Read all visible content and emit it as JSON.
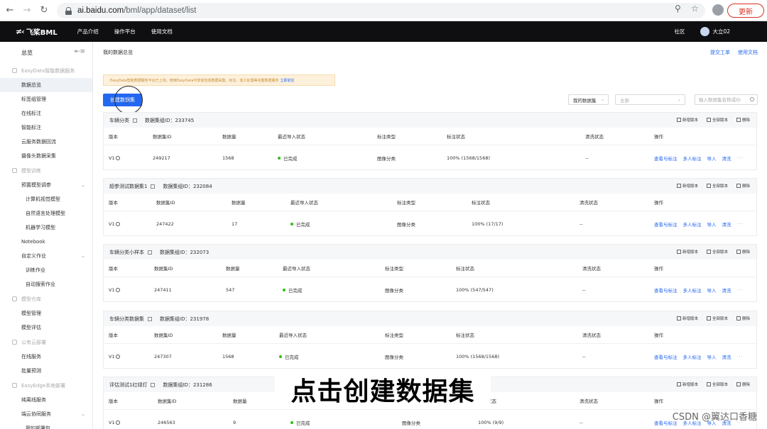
{
  "browser": {
    "url_host": "ai.baidu.com",
    "url_path": "/bml/app/dataset/list",
    "update_label": "更新"
  },
  "topbar": {
    "logo": "飞桨BML",
    "nav": [
      "产品介绍",
      "操作平台",
      "使用文档"
    ],
    "community": "社区",
    "user": "大立02"
  },
  "sidebar": {
    "header": "总览",
    "items": [
      {
        "kind": "group",
        "label": "EasyData智能数据服务"
      },
      {
        "kind": "item",
        "label": "数据总览",
        "active": true
      },
      {
        "kind": "item",
        "label": "标签组管理"
      },
      {
        "kind": "item",
        "label": "在线标注"
      },
      {
        "kind": "item",
        "label": "智能标注"
      },
      {
        "kind": "item",
        "label": "云服务数据回流"
      },
      {
        "kind": "item",
        "label": "摄像头数据采集"
      },
      {
        "kind": "group",
        "label": "模型训练"
      },
      {
        "kind": "item",
        "label": "预置模型调参",
        "chevron": true
      },
      {
        "kind": "sub",
        "label": "计算机视觉模型"
      },
      {
        "kind": "sub",
        "label": "自然语言处理模型"
      },
      {
        "kind": "sub",
        "label": "机器学习模型"
      },
      {
        "kind": "item",
        "label": "Notebook"
      },
      {
        "kind": "item",
        "label": "自定义作业",
        "chevron": true
      },
      {
        "kind": "sub",
        "label": "训练作业"
      },
      {
        "kind": "sub",
        "label": "自动搜索作业"
      },
      {
        "kind": "group",
        "label": "模型仓库"
      },
      {
        "kind": "item",
        "label": "模型管理"
      },
      {
        "kind": "item",
        "label": "模型评估"
      },
      {
        "kind": "group",
        "label": "公有云部署"
      },
      {
        "kind": "item",
        "label": "在线服务"
      },
      {
        "kind": "item",
        "label": "批量预测"
      },
      {
        "kind": "group",
        "label": "EasyEdge本地部署"
      },
      {
        "kind": "item",
        "label": "纯离线服务"
      },
      {
        "kind": "item",
        "label": "端云协同服务",
        "chevron": true
      },
      {
        "kind": "sub",
        "label": "我的部署包"
      }
    ]
  },
  "main": {
    "breadcrumb": "我的数据总览",
    "header_links": [
      "提交工单",
      "使用文档"
    ],
    "notice": "EasyData智能数据服务平台已上线，使用EasyData可享受包括数据采集、标注、加工处理等完整数据服务",
    "notice_link": "立即前往",
    "create_button": "创建数据集",
    "filter_mine": "我的数据集",
    "filter_all": "全部",
    "search_placeholder": "输入数据集名称或ID",
    "card_actions": [
      "新增版本",
      "全部版本",
      "删除"
    ],
    "group_id_label": "数据集组ID：",
    "columns": [
      "版本",
      "数据集ID",
      "数据量",
      "最近导入状态",
      "标注类型",
      "标注状态",
      "清洗状态",
      "操作"
    ],
    "ops": [
      "查看与标注",
      "多人标注",
      "导入",
      "清洗"
    ],
    "datasets": [
      {
        "name": "车辆分类",
        "group_id": "233745",
        "version": "V1",
        "dataset_id": "249217",
        "count": "1568",
        "import_status": "已完成",
        "label_type": "图像分类",
        "label_status": "100% (1568/1568)",
        "clean_status": "--"
      },
      {
        "name": "超参测试数据集1",
        "group_id": "232084",
        "version": "V1",
        "dataset_id": "247422",
        "count": "17",
        "import_status": "已完成",
        "label_type": "图像分类",
        "label_status": "100% (17/17)",
        "clean_status": "--"
      },
      {
        "name": "车辆分类小样本",
        "group_id": "232073",
        "version": "V1",
        "dataset_id": "247411",
        "count": "547",
        "import_status": "已完成",
        "label_type": "图像分类",
        "label_status": "100% (547/547)",
        "clean_status": "--"
      },
      {
        "name": "车辆分类数据集",
        "group_id": "231978",
        "version": "V1",
        "dataset_id": "247307",
        "count": "1568",
        "import_status": "已完成",
        "label_type": "图像分类",
        "label_status": "100% (1568/1568)",
        "clean_status": "--"
      },
      {
        "name": "评估测试1红绿灯",
        "group_id": "231286",
        "version": "V1",
        "dataset_id": "246563",
        "count": "9",
        "import_status": "已完成",
        "label_type": "图像分类",
        "label_status": "100% (9/9)",
        "clean_status": "--"
      }
    ]
  },
  "caption": "点击创建数据集",
  "watermark": "CSDN @翼达口香糖"
}
